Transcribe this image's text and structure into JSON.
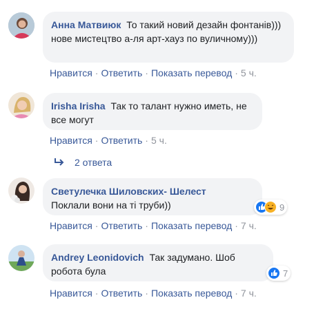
{
  "comments": [
    {
      "author": "Анна Матвиюк",
      "text": "То такий новий дезайн фонтанів))) нове мистецтво а-ля арт-хауз по вуличному)))",
      "actions": {
        "like": "Нравится",
        "reply": "Ответить",
        "translate": "Показать перевод",
        "time": "5 ч."
      }
    },
    {
      "author": "Irisha Irisha",
      "text": "Так то талант нужно иметь, не все могут",
      "actions": {
        "like": "Нравится",
        "reply": "Ответить",
        "time": "5 ч."
      },
      "replies_label": "2 ответа"
    },
    {
      "author": "Светулечка Шиловских- Шелест",
      "text": "Поклали вони на ті труби))",
      "reactions": {
        "icons": [
          "like-icon",
          "haha-icon"
        ],
        "count": "9"
      },
      "actions": {
        "like": "Нравится",
        "reply": "Ответить",
        "translate": "Показать перевод",
        "time": "7 ч."
      }
    },
    {
      "author": "Andrey Leonidovich",
      "text": "Так задумано. Шоб робота була",
      "reactions": {
        "icons": [
          "like-icon"
        ],
        "count": "7"
      },
      "actions": {
        "like": "Нравится",
        "reply": "Ответить",
        "translate": "Показать перевод",
        "time": "7 ч."
      }
    }
  ],
  "colors": {
    "link": "#385898",
    "meta": "#90949c",
    "bubble": "#f2f3f5",
    "like": "#1877f2",
    "haha": "#f7b125"
  }
}
